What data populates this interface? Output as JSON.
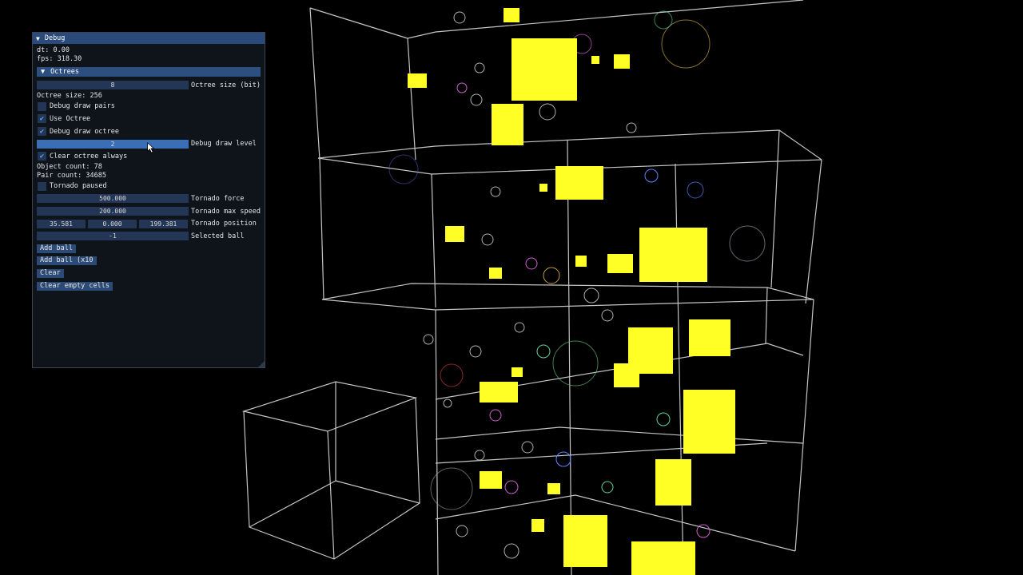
{
  "debug": {
    "title": "Debug",
    "dt": "dt: 0.00",
    "fps": "fps: 318.30",
    "octrees_header": "Octrees",
    "octree_size_bit_value": "8",
    "octree_size_bit_label": "Octree size (bit)",
    "octree_size": "Octree size: 256",
    "debug_draw_pairs": {
      "label": "Debug draw pairs",
      "checked": false
    },
    "use_octree": {
      "label": "Use Octree",
      "checked": true
    },
    "debug_draw_octree": {
      "label": "Debug draw octree",
      "checked": true
    },
    "debug_draw_level_value": "2",
    "debug_draw_level_label": "Debug draw level",
    "clear_octree_always": {
      "label": "Clear octree always",
      "checked": true
    },
    "object_count": "Object count: 78",
    "pair_count": "Pair count: 34685",
    "tornado_paused": {
      "label": "Tornado paused",
      "checked": false
    },
    "tornado_force_value": "500.000",
    "tornado_force_label": "Tornado force",
    "tornado_max_speed_value": "200.000",
    "tornado_max_speed_label": "Tornado max speed",
    "tornado_position_values": [
      "35.581",
      "0.000",
      "199.381"
    ],
    "tornado_position_label": "Tornado position",
    "selected_ball_value": "-1",
    "selected_ball_label": "Selected ball",
    "add_ball": "Add ball",
    "add_ball_x10": "Add ball (x10",
    "clear": "Clear",
    "clear_empty_cells": "Clear empty cells",
    "checkmark": "✔",
    "collapse_glyph": "▼"
  },
  "scene": {
    "background": "#000000",
    "wire_color": "#ffffff",
    "cube_color": "#ffff22",
    "sphere_colors": [
      "#b0b0b0",
      "#d060d0",
      "#60d0a0",
      "#e04040",
      "#6080ff",
      "#c0a040"
    ]
  }
}
